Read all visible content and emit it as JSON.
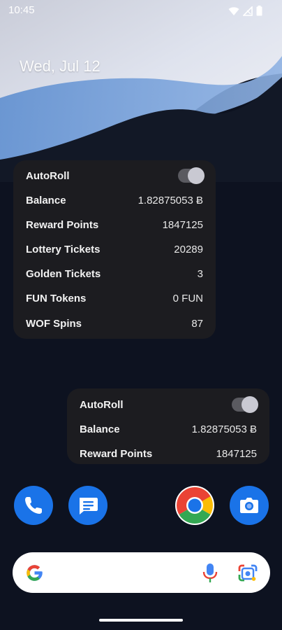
{
  "status_bar": {
    "time": "10:45"
  },
  "home": {
    "date": "Wed, Jul 12"
  },
  "widget_large": {
    "autoroll": {
      "label": "AutoRoll",
      "enabled": true
    },
    "rows": [
      {
        "label": "Balance",
        "value": "1.82875053 Ƀ"
      },
      {
        "label": "Reward Points",
        "value": "1847125"
      },
      {
        "label": "Lottery Tickets",
        "value": "20289"
      },
      {
        "label": "Golden Tickets",
        "value": "3"
      },
      {
        "label": "FUN Tokens",
        "value": "0 FUN"
      },
      {
        "label": "WOF Spins",
        "value": "87"
      }
    ]
  },
  "widget_small": {
    "autoroll": {
      "label": "AutoRoll",
      "enabled": true
    },
    "rows": [
      {
        "label": "Balance",
        "value": "1.82875053 Ƀ"
      },
      {
        "label": "Reward Points",
        "value": "1847125"
      }
    ]
  },
  "dock": {
    "apps": [
      {
        "icon": "phone-icon",
        "color": "#1a73e8"
      },
      {
        "icon": "messages-icon",
        "color": "#1a73e8"
      },
      {
        "icon": "chrome-icon",
        "color": "#ffffff"
      },
      {
        "icon": "camera-icon",
        "color": "#1a73e8"
      }
    ]
  },
  "search_bar": {
    "icons": [
      "google-logo-icon",
      "microphone-icon",
      "lens-icon"
    ]
  },
  "colors": {
    "widget_bg": "#1c1c20",
    "accent_blue": "#1a73e8"
  }
}
